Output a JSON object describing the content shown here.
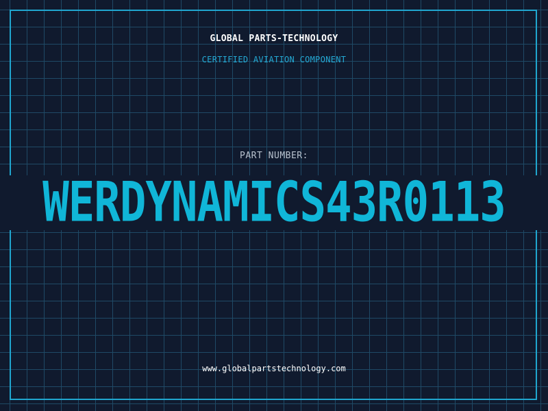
{
  "header": {
    "company": "GLOBAL PARTS-TECHNOLOGY",
    "tagline": "CERTIFIED AVIATION COMPONENT"
  },
  "part": {
    "label": "PART NUMBER:",
    "number": "WERDYNAMICS43R0113"
  },
  "footer": {
    "website": "www.globalpartstechnology.com"
  },
  "colors": {
    "background": "#101a2e",
    "grid": "#1f4a66",
    "accent": "#20a6cf",
    "part_number": "#10b6d8"
  }
}
